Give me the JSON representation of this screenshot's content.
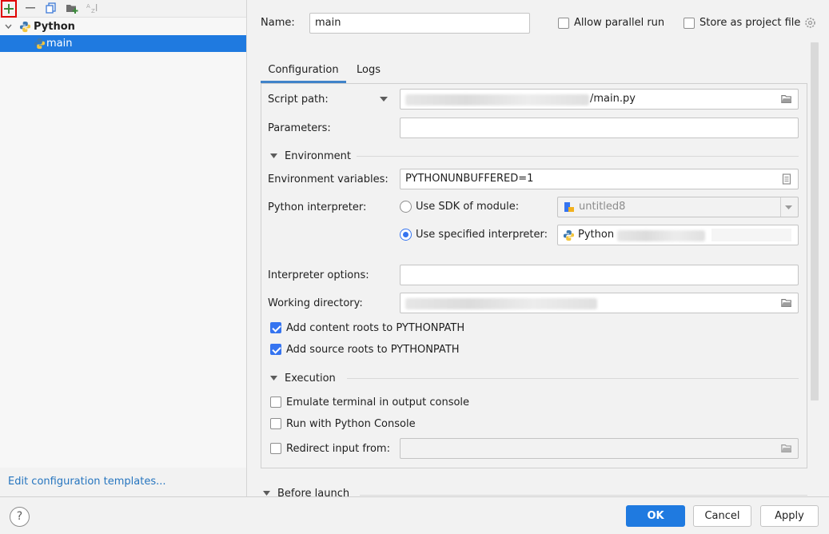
{
  "toolbar": {
    "add_icon": "plus-icon",
    "remove_icon": "minus-icon",
    "copy_icon": "copy-icon",
    "folder_icon": "new-folder-icon",
    "sort_icon": "sort-alphabetically-icon"
  },
  "tree": {
    "group_label": "Python",
    "items": [
      {
        "label": "main",
        "selected": true
      }
    ]
  },
  "footer_link": "Edit configuration templates...",
  "header": {
    "name_label": "Name:",
    "name_value": "main",
    "allow_parallel_label": "Allow parallel run",
    "allow_parallel_checked": false,
    "store_project_label": "Store as project file",
    "store_project_checked": false
  },
  "tabs": [
    {
      "label": "Configuration",
      "active": true
    },
    {
      "label": "Logs",
      "active": false
    }
  ],
  "config": {
    "script_path_label": "Script path:",
    "script_path_value": "/main.py",
    "parameters_label": "Parameters:",
    "parameters_value": "",
    "environment_section": "Environment",
    "env_vars_label": "Environment variables:",
    "env_vars_value": "PYTHONUNBUFFERED=1",
    "interpreter_label": "Python interpreter:",
    "use_sdk_label": "Use SDK of module:",
    "sdk_module_value": "untitled8",
    "use_specified_label": "Use specified interpreter:",
    "specified_interpreter_value": "Python",
    "interpreter_options_label": "Interpreter options:",
    "interpreter_options_value": "",
    "working_dir_label": "Working directory:",
    "add_content_roots_label": "Add content roots to PYTHONPATH",
    "add_content_roots_checked": true,
    "add_source_roots_label": "Add source roots to PYTHONPATH",
    "add_source_roots_checked": true,
    "execution_section": "Execution",
    "emulate_terminal_label": "Emulate terminal in output console",
    "run_console_label": "Run with Python Console",
    "redirect_input_label": "Redirect input from:",
    "before_launch_section": "Before launch"
  },
  "buttons": {
    "help": "?",
    "ok": "OK",
    "cancel": "Cancel",
    "apply": "Apply"
  },
  "colors": {
    "accent": "#1f7ae0",
    "link": "#2675bf",
    "highlight_border": "#e00000"
  }
}
